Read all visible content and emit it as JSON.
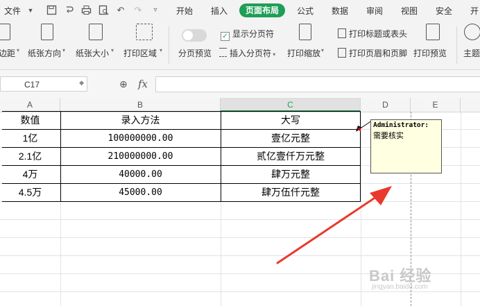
{
  "menubar": {
    "file_label": "文件",
    "tabs": [
      "开始",
      "插入",
      "页面布局",
      "公式",
      "数据",
      "审阅",
      "视图",
      "安全",
      "开"
    ],
    "active_tab": "页面布局"
  },
  "ribbon": {
    "margins_label": "边距",
    "orientation_label": "纸张方向",
    "size_label": "纸张大小",
    "print_area_label": "打印区域",
    "page_break_preview_label": "分页预览",
    "show_page_breaks_label": "显示分页符",
    "insert_page_break_label": "插入分页符",
    "print_scaling_label": "打印缩放",
    "print_titles_label": "打印标题或表头",
    "print_header_footer_label": "打印页眉和页脚",
    "print_preview_label": "打印预览",
    "theme_label": "主题"
  },
  "formula_bar": {
    "name_box_value": "C17",
    "fx_label": "fx",
    "formula_value": ""
  },
  "columns": [
    "A",
    "B",
    "C",
    "D",
    "E"
  ],
  "selected_column": "C",
  "table": {
    "headers": [
      "数值",
      "录入方法",
      "大写"
    ],
    "rows": [
      [
        "1亿",
        "100000000.00",
        "壹亿元整"
      ],
      [
        "2.1亿",
        "210000000.00",
        "贰亿壹仟万元整"
      ],
      [
        "4万",
        "40000.00",
        "肆万元整"
      ],
      [
        "4.5万",
        "45000.00",
        "肆万伍仟元整"
      ]
    ]
  },
  "comment": {
    "author": "Administrator:",
    "text": "需要核实"
  },
  "watermark": {
    "text": "Bai 经验",
    "sub": "jingyan.baidu.com"
  },
  "colors": {
    "accent": "#1e9e56",
    "annotation_arrow": "#e8392c",
    "comment_bg": "#ffffe1"
  }
}
